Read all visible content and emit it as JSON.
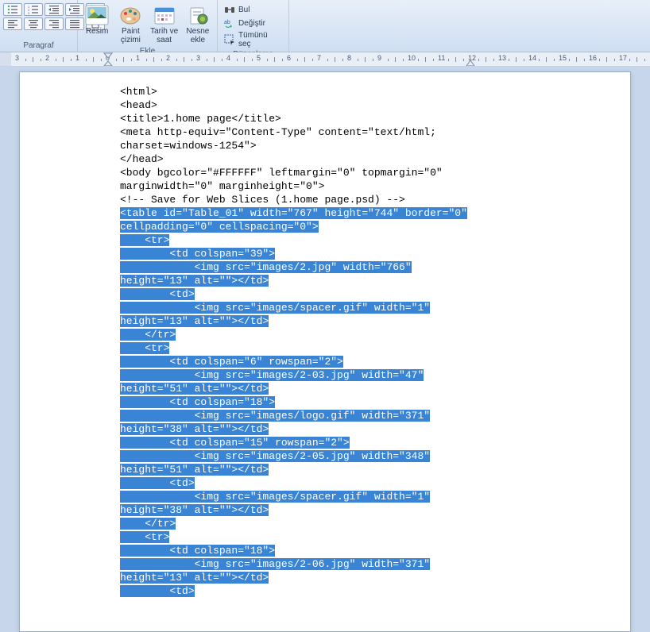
{
  "ribbon": {
    "paragraph_label": "Paragraf",
    "insert_label": "Ekle",
    "edit_label": "Düzenleme",
    "resim": "Resim",
    "paint": "Paint\nçizimi",
    "tarih": "Tarih\nve saat",
    "nesne": "Nesne\nekle",
    "bul": "Bul",
    "degistir": "Değiştir",
    "tumunu": "Tümünü seç"
  },
  "doc_lines": [
    {
      "t": "<html>",
      "s": false
    },
    {
      "t": "<head>",
      "s": false
    },
    {
      "t": "<title>1.home page</title>",
      "s": false
    },
    {
      "t": "<meta http-equiv=\"Content-Type\" content=\"text/html;",
      "s": false
    },
    {
      "t": "charset=windows-1254\">",
      "s": false
    },
    {
      "t": "</head>",
      "s": false
    },
    {
      "t": "<body bgcolor=\"#FFFFFF\" leftmargin=\"0\" topmargin=\"0\"",
      "s": false
    },
    {
      "t": "marginwidth=\"0\" marginheight=\"0\">",
      "s": false
    },
    {
      "t": "<!-- Save for Web Slices (1.home page.psd) -->",
      "s": false
    },
    {
      "t": "<table id=\"Table_01\" width=\"767\" height=\"744\" border=\"0\"",
      "s": true
    },
    {
      "t": "cellpadding=\"0\" cellspacing=\"0\">",
      "s": true
    },
    {
      "t": "    <tr>",
      "s": true
    },
    {
      "t": "        <td colspan=\"39\">",
      "s": true
    },
    {
      "t": "            <img src=\"images/2.jpg\" width=\"766\"",
      "s": true
    },
    {
      "t": "height=\"13\" alt=\"\"></td>",
      "s": true
    },
    {
      "t": "        <td>",
      "s": true
    },
    {
      "t": "            <img src=\"images/spacer.gif\" width=\"1\"",
      "s": true
    },
    {
      "t": "height=\"13\" alt=\"\"></td>",
      "s": true
    },
    {
      "t": "    </tr>",
      "s": true
    },
    {
      "t": "    <tr>",
      "s": true
    },
    {
      "t": "        <td colspan=\"6\" rowspan=\"2\">",
      "s": true
    },
    {
      "t": "            <img src=\"images/2-03.jpg\" width=\"47\"",
      "s": true
    },
    {
      "t": "height=\"51\" alt=\"\"></td>",
      "s": true
    },
    {
      "t": "        <td colspan=\"18\">",
      "s": true
    },
    {
      "t": "            <img src=\"images/logo.gif\" width=\"371\"",
      "s": true
    },
    {
      "t": "height=\"38\" alt=\"\"></td>",
      "s": true
    },
    {
      "t": "        <td colspan=\"15\" rowspan=\"2\">",
      "s": true
    },
    {
      "t": "            <img src=\"images/2-05.jpg\" width=\"348\"",
      "s": true
    },
    {
      "t": "height=\"51\" alt=\"\"></td>",
      "s": true
    },
    {
      "t": "        <td>",
      "s": true
    },
    {
      "t": "            <img src=\"images/spacer.gif\" width=\"1\"",
      "s": true
    },
    {
      "t": "height=\"38\" alt=\"\"></td>",
      "s": true
    },
    {
      "t": "    </tr>",
      "s": true
    },
    {
      "t": "    <tr>",
      "s": true
    },
    {
      "t": "        <td colspan=\"18\">",
      "s": true
    },
    {
      "t": "            <img src=\"images/2-06.jpg\" width=\"371\"",
      "s": true
    },
    {
      "t": "height=\"13\" alt=\"\"></td>",
      "s": true
    },
    {
      "t": "        <td>",
      "s": true
    }
  ]
}
